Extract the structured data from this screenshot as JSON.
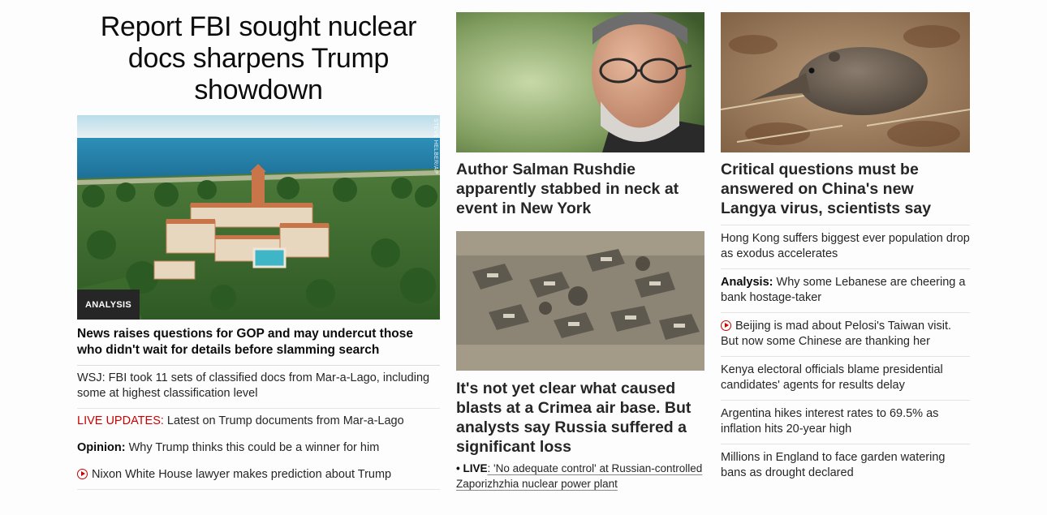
{
  "lead": {
    "headline": "Report FBI sought nuclear docs sharpens Trump showdown",
    "image_badge": "ANALYSIS",
    "image_credit": "STEVE HELBER/AP",
    "sub_headline": "News raises questions for GOP and may undercut those who didn't wait for details before slamming search",
    "links": [
      {
        "kicker": "",
        "text": "WSJ: FBI took 11 sets of classified docs from Mar-a-Lago, including some at highest classification level"
      },
      {
        "kicker": "LIVE UPDATES:",
        "text": " Latest on Trump documents from Mar-a-Lago"
      },
      {
        "kicker": "Opinion:",
        "text": " Why Trump thinks this could be a winner for him"
      },
      {
        "kicker": "",
        "text": "Nixon White House lawyer makes prediction about Trump",
        "icon": "play-icon"
      }
    ]
  },
  "middle": {
    "story1_title": "Author Salman Rushdie apparently stabbed in neck at event in New York",
    "story2_title": "It's not yet clear what caused blasts at a Crimea air base. But analysts say Russia suffered a significant loss",
    "live_prefix": "• LIVE",
    "live_text": ": 'No adequate control' at Russian-controlled Zaporizhzhia nuclear power plant"
  },
  "right": {
    "story_title": "Critical questions must be answered on China's new Langya virus, scientists say",
    "links": [
      {
        "kicker": "",
        "text": "Hong Kong suffers biggest ever population drop as exodus accelerates"
      },
      {
        "kicker": "Analysis:",
        "text": " Why some Lebanese are cheering a bank hostage-taker"
      },
      {
        "kicker": "",
        "text": "Beijing is mad about Pelosi's Taiwan visit. But now some Chinese are thanking her",
        "icon": "play-icon"
      },
      {
        "kicker": "",
        "text": "Kenya electoral officials blame presidential candidates' agents for results delay"
      },
      {
        "kicker": "",
        "text": "Argentina hikes interest rates to 69.5% as inflation hits 20-year high"
      },
      {
        "kicker": "",
        "text": "Millions in England to face garden watering bans as drought declared"
      }
    ]
  },
  "colors": {
    "live_red": "#cc0000",
    "text": "#0c0c0c",
    "badge_bg": "#262626"
  }
}
